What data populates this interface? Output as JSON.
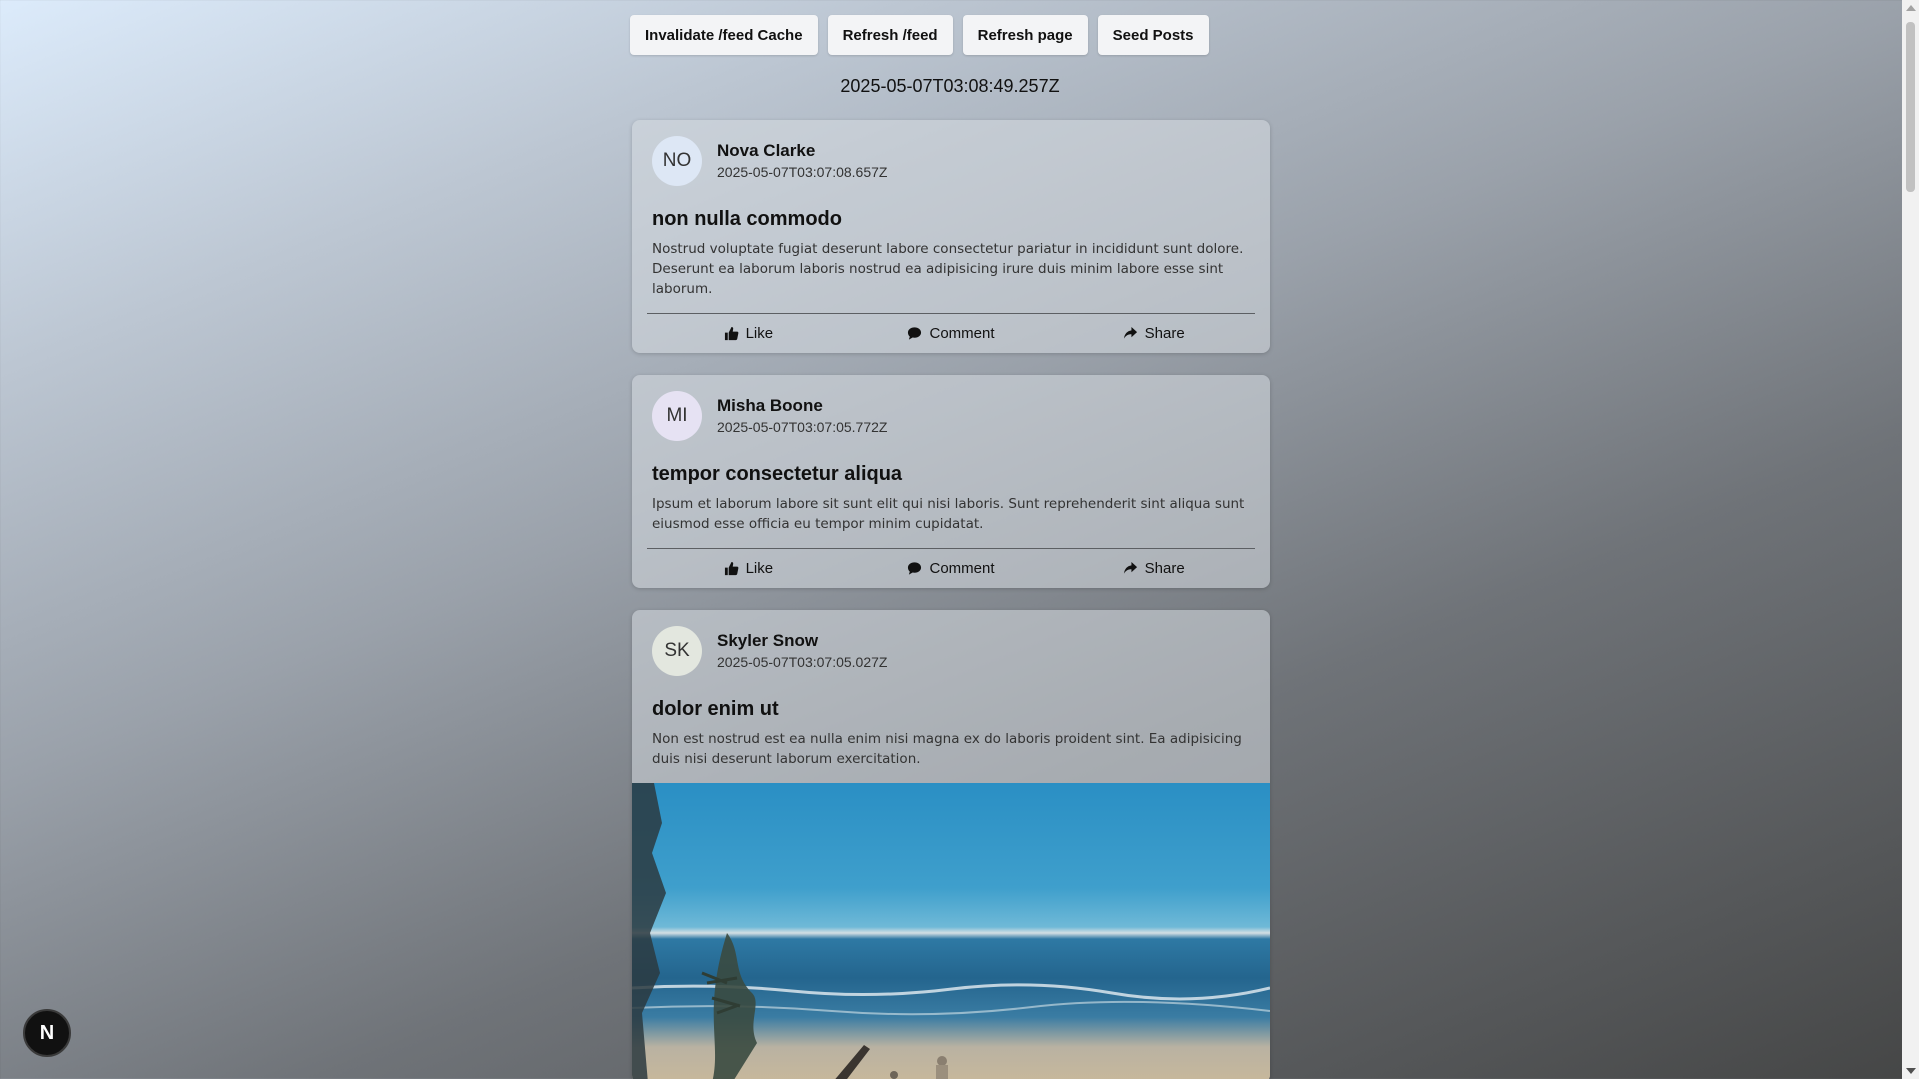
{
  "toolbar": {
    "invalidate_label": "Invalidate /feed Cache",
    "refresh_feed_label": "Refresh /feed",
    "refresh_page_label": "Refresh page",
    "seed_posts_label": "Seed Posts"
  },
  "page_timestamp": "2025-05-07T03:08:49.257Z",
  "actions": {
    "like": "Like",
    "comment": "Comment",
    "share": "Share"
  },
  "posts": [
    {
      "initials": "NO",
      "avatar_color": "#dde7f5",
      "author": "Nova Clarke",
      "time": "2025-05-07T03:07:08.657Z",
      "title": "non nulla commodo",
      "body": "Nostrud voluptate fugiat deserunt labore consectetur pariatur in incididunt sunt dolore. Deserunt ea laborum laboris nostrud ea adipisicing irure duis minim labore esse sint laborum."
    },
    {
      "initials": "MI",
      "avatar_color": "#e6e2f3",
      "author": "Misha Boone",
      "time": "2025-05-07T03:07:05.772Z",
      "title": "tempor consectetur aliqua",
      "body": "Ipsum et laborum labore sit sunt elit qui nisi laboris. Sunt reprehenderit sint aliqua sunt eiusmod esse officia eu tempor minim cupidatat."
    },
    {
      "initials": "SK",
      "avatar_color": "#e3e7df",
      "author": "Skyler Snow",
      "time": "2025-05-07T03:07:05.027Z",
      "title": "dolor enim ut",
      "body": "Non est nostrud est ea nulla enim nisi magna ex do laboris proident sint. Ea adipisicing duis nisi deserunt laborum exercitation."
    }
  ],
  "next_badge": "N"
}
